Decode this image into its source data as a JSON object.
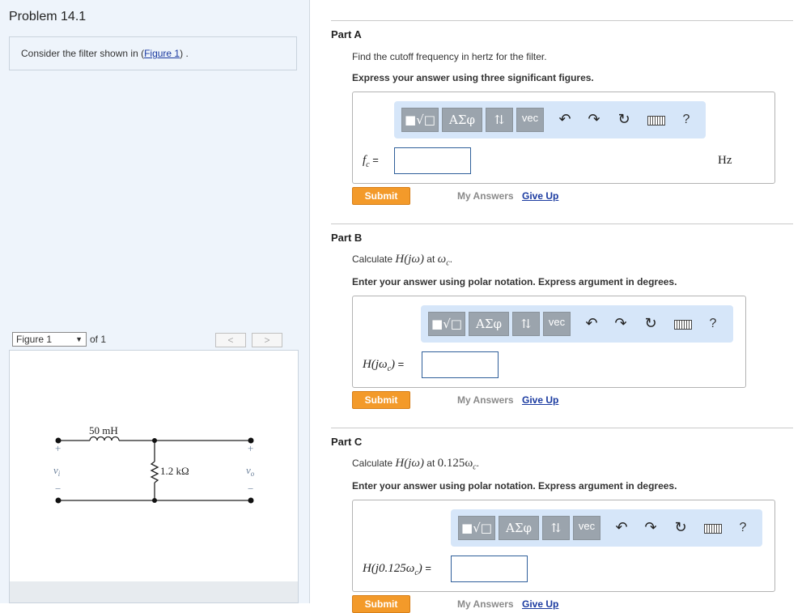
{
  "problem": {
    "title": "Problem 14.1",
    "intro_prefix": "Consider the filter shown in (",
    "intro_link": "Figure 1",
    "intro_suffix": ") ."
  },
  "figure": {
    "select_label": "Figure 1",
    "of_label": "of 1",
    "prev": "<",
    "next": ">",
    "inductor": "50 mH",
    "resistor": "1.2 kΩ",
    "vi": "v",
    "vi_sub": "i",
    "vo": "v",
    "vo_sub": "o",
    "plus": "+",
    "minus": "−"
  },
  "toolbar": {
    "templates": "■√□",
    "greek": "ΑΣφ",
    "arrows": "⇅",
    "vec": "vec",
    "undo": "↶",
    "redo": "↷",
    "reset": "↻",
    "help": "?"
  },
  "parts": [
    {
      "title": "Part A",
      "question": "Find the cutoff frequency in hertz for the filter.",
      "instruction": "Express your answer using three significant figures.",
      "label": "fc =",
      "label_main": "f",
      "label_sub": "c",
      "label_eq": " =",
      "value": "",
      "unit": "Hz",
      "submit": "Submit",
      "my_answers": "My Answers",
      "give_up": "Give Up"
    },
    {
      "title": "Part B",
      "q_prefix": "Calculate ",
      "q_math": "H(jω)",
      "q_mid": " at ",
      "q_math2": "ω",
      "q_math2_sub": "c",
      "q_suffix": ".",
      "instruction": "Enter your answer using polar notation. Express argument in degrees.",
      "label_main": "H(jω",
      "label_sub": "c",
      "label_end": ")",
      "label_eq": " =",
      "value": "",
      "submit": "Submit",
      "my_answers": "My Answers",
      "give_up": "Give Up"
    },
    {
      "title": "Part C",
      "q_prefix": "Calculate ",
      "q_math": "H(jω)",
      "q_mid": " at ",
      "q_math2": "0.125ω",
      "q_math2_sub": "c",
      "q_suffix": ".",
      "instruction": "Enter your answer using polar notation. Express argument in degrees.",
      "label_main": "H(j0.125ω",
      "label_sub": "c",
      "label_end": ")",
      "label_eq": " =",
      "value": "",
      "submit": "Submit",
      "my_answers": "My Answers",
      "give_up": "Give Up"
    }
  ]
}
